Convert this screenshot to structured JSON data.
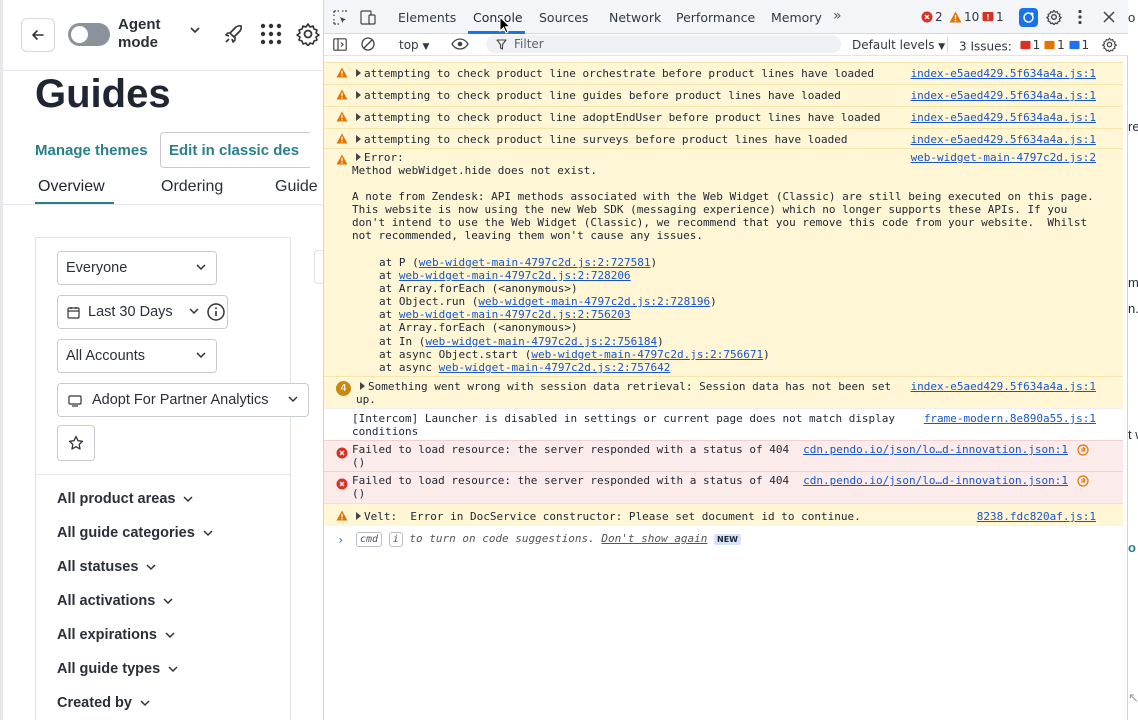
{
  "app": {
    "agent_mode_label": "Agent mode",
    "page_title": "Guides",
    "manage_themes": "Manage themes",
    "edit_classic": "Edit in classic des",
    "tabs": [
      {
        "label": "Overview",
        "active": true
      },
      {
        "label": "Ordering",
        "active": false
      },
      {
        "label": "Guide",
        "active": false
      }
    ],
    "filters": {
      "segment": "Everyone",
      "date_range": "Last 30 Days",
      "accounts": "All Accounts",
      "app": "Adopt For Partner Analytics"
    },
    "facets": [
      "All product areas",
      "All guide categories",
      "All statuses",
      "All activations",
      "All expirations",
      "All guide types",
      "Created by"
    ]
  },
  "devtools": {
    "tabs": [
      "Elements",
      "Console",
      "Sources",
      "Network",
      "Performance",
      "Memory"
    ],
    "active_tab": "Console",
    "counts": {
      "errors": "2",
      "warnings": "10",
      "issues_flag": "1"
    },
    "context": "top",
    "filter_placeholder": "Filter",
    "levels": "Default levels",
    "issues": {
      "label": "3 Issues:",
      "a": "1",
      "b": "1",
      "c": "1"
    },
    "logs": {
      "w1": {
        "msg": "attempting to check product line orchestrate before product lines have loaded",
        "src": "index-e5aed429.5f634a4a.js:1"
      },
      "w2": {
        "msg": "attempting to check product line guides before product lines have loaded",
        "src": "index-e5aed429.5f634a4a.js:1"
      },
      "w3": {
        "msg": "attempting to check product line adoptEndUser before product lines have loaded",
        "src": "index-e5aed429.5f634a4a.js:1"
      },
      "w4": {
        "msg": "attempting to check product line surveys before product lines have loaded",
        "src": "index-e5aed429.5f634a4a.js:1"
      },
      "w5": {
        "head": "Error:",
        "line2": "Method webWidget.hide does not exist.",
        "src": "web-widget-main-4797c2d.js:2",
        "p1": "A note from Zendesk: API methods associated with the Web Widget (Classic) are still being executed on this page.",
        "p2": "This website is now using the new Web SDK (messaging experience) which no longer supports these APIs. If you",
        "p3": "don't intend to use the Web Widget (Classic), we recommend that you remove this code from your website.  Whilst",
        "p4": "not recommended, leaving them won't cause any issues.",
        "stack": [
          {
            "pre": "at P (",
            "link": "web-widget-main-4797c2d.js:2:727581",
            "post": ")"
          },
          {
            "pre": "at ",
            "link": "web-widget-main-4797c2d.js:2:728206",
            "post": ""
          },
          {
            "pre": "at Array.forEach (<anonymous>)",
            "link": "",
            "post": ""
          },
          {
            "pre": "at Object.run (",
            "link": "web-widget-main-4797c2d.js:2:728196",
            "post": ")"
          },
          {
            "pre": "at ",
            "link": "web-widget-main-4797c2d.js:2:756203",
            "post": ""
          },
          {
            "pre": "at Array.forEach (<anonymous>)",
            "link": "",
            "post": ""
          },
          {
            "pre": "at In (",
            "link": "web-widget-main-4797c2d.js:2:756184",
            "post": ")"
          },
          {
            "pre": "at async Object.start (",
            "link": "web-widget-main-4797c2d.js:2:756671",
            "post": ")"
          },
          {
            "pre": "at async ",
            "link": "web-widget-main-4797c2d.js:2:757642",
            "post": ""
          }
        ]
      },
      "w6": {
        "count": "4",
        "l1": "Something went wrong with session data retrieval: Session data has not been set",
        "l2": "up.",
        "src": "index-e5aed429.5f634a4a.js:1"
      },
      "i1": {
        "l1": "[Intercom] Launcher is disabled in settings or current page does not match display",
        "l2": "conditions",
        "src": "frame-modern.8e890a55.js:1"
      },
      "e1": {
        "l1": "Failed to load resource: the server responded with a status of 404",
        "l2": "()",
        "src": "cdn.pendo.io/json/lo…d-innovation.json:1"
      },
      "e2": {
        "l1": "Failed to load resource: the server responded with a status of 404",
        "l2": "()",
        "src": "cdn.pendo.io/json/lo…d-innovation.json:1"
      },
      "w7": {
        "msg": "Velt:  Error in DocService constructor: Please set document id to continue.",
        "src": "8238.fdc820af.js:1"
      }
    },
    "prompt": {
      "kbd1": "cmd",
      "kbd2": "i",
      "text": "to turn on code suggestions.",
      "dont_show": "Don't show again",
      "new": "NEW"
    }
  },
  "right_strip": [
    "o",
    "re",
    "m",
    "n.",
    "t w",
    "m",
    "o"
  ],
  "colors": {
    "accent": "#2a7f8c",
    "devtools_blue": "#1a73e8",
    "warn_bg": "#fef6d5",
    "error_bg": "#fcebeb"
  }
}
